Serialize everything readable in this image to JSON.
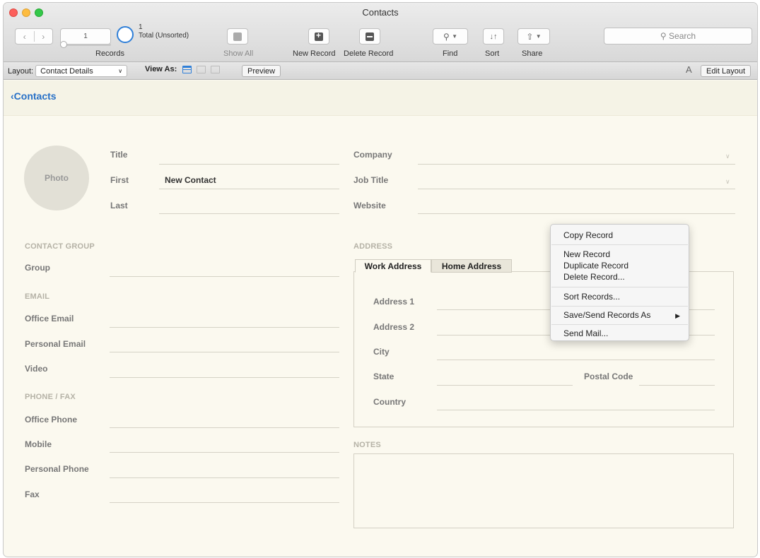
{
  "window": {
    "title": "Contacts"
  },
  "toolbar": {
    "record_number": "1",
    "record_count": "1",
    "record_status": "Total (Unsorted)",
    "records_label": "Records",
    "show_all": "Show All",
    "new_record": "New Record",
    "delete_record": "Delete Record",
    "find": "Find",
    "sort": "Sort",
    "share": "Share",
    "search_placeholder": "Search"
  },
  "layoutbar": {
    "layout_label": "Layout:",
    "layout_value": "Contact Details",
    "view_as_label": "View As:",
    "preview": "Preview",
    "font_icon": "A",
    "edit_layout": "Edit Layout"
  },
  "nav": {
    "back": "Contacts"
  },
  "contact": {
    "photo": "Photo",
    "title_label": "Title",
    "first_label": "First",
    "first_value": "New Contact",
    "last_label": "Last",
    "company_label": "Company",
    "job_title_label": "Job Title",
    "website_label": "Website"
  },
  "sections": {
    "contact_group": "CONTACT GROUP",
    "group": "Group",
    "email": "EMAIL",
    "office_email": "Office Email",
    "personal_email": "Personal Email",
    "video": "Video",
    "phone_fax": "PHONE / FAX",
    "office_phone": "Office Phone",
    "mobile": "Mobile",
    "personal_phone": "Personal Phone",
    "fax": "Fax"
  },
  "address": {
    "section": "ADDRESS",
    "tabs": [
      "Work Address",
      "Home Address"
    ],
    "address1": "Address 1",
    "address2": "Address 2",
    "city": "City",
    "state": "State",
    "postal_code": "Postal Code",
    "country": "Country"
  },
  "notes": {
    "section": "NOTES"
  },
  "context_menu": {
    "copy_record": "Copy Record",
    "new_record": "New Record",
    "duplicate_record": "Duplicate Record",
    "delete_record": "Delete Record...",
    "sort_records": "Sort Records...",
    "save_send": "Save/Send Records As",
    "send_mail": "Send Mail..."
  }
}
